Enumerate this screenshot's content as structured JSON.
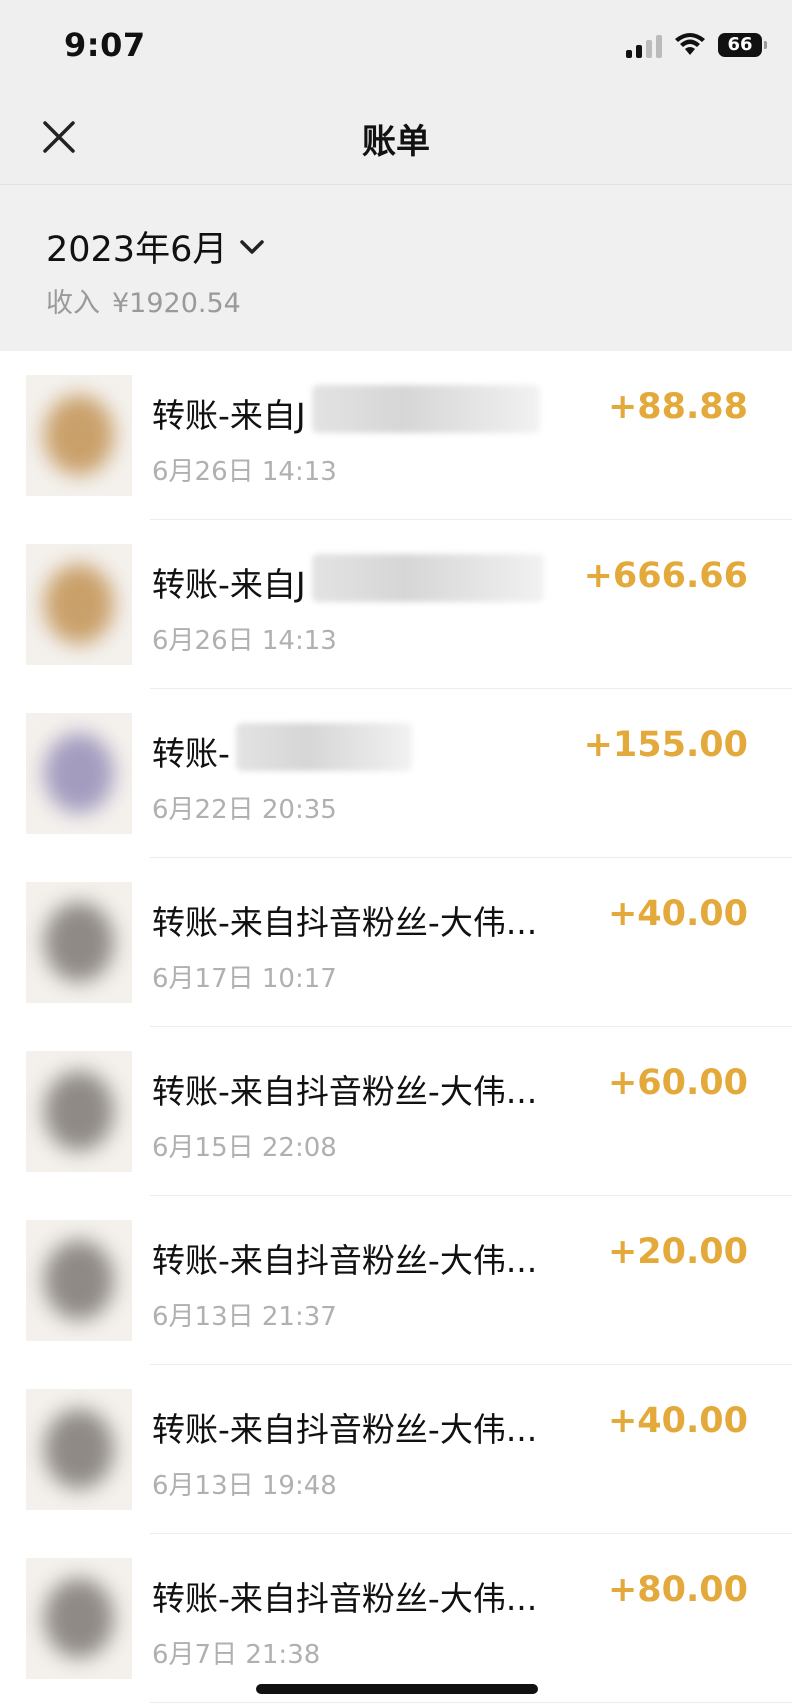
{
  "status": {
    "time": "9:07",
    "battery": "66"
  },
  "nav": {
    "title": "账单"
  },
  "summary": {
    "month": "2023年6月",
    "income_label": "收入",
    "income_amount": "¥1920.54"
  },
  "transactions": [
    {
      "title": "转账-来自J",
      "date": "6月26日 14:13",
      "amount": "+88.88",
      "avatar_color": "#c9a06a",
      "redacted": true
    },
    {
      "title": "转账-来自J",
      "date": "6月26日 14:13",
      "amount": "+666.66",
      "avatar_color": "#c9a06a",
      "redacted": true
    },
    {
      "title": "转账-",
      "date": "6月22日 20:35",
      "amount": "+155.00",
      "avatar_color": "#a49cbf",
      "redacted": true
    },
    {
      "title": "转账-来自抖音粉丝-大伟...",
      "date": "6月17日 10:17",
      "amount": "+40.00",
      "avatar_color": "#8f8a86",
      "redacted": false
    },
    {
      "title": "转账-来自抖音粉丝-大伟...",
      "date": "6月15日 22:08",
      "amount": "+60.00",
      "avatar_color": "#8f8a86",
      "redacted": false
    },
    {
      "title": "转账-来自抖音粉丝-大伟...",
      "date": "6月13日 21:37",
      "amount": "+20.00",
      "avatar_color": "#8f8a86",
      "redacted": false
    },
    {
      "title": "转账-来自抖音粉丝-大伟...",
      "date": "6月13日 19:48",
      "amount": "+40.00",
      "avatar_color": "#8f8a86",
      "redacted": false
    },
    {
      "title": "转账-来自抖音粉丝-大伟...",
      "date": "6月7日 21:38",
      "amount": "+80.00",
      "avatar_color": "#8f8a86",
      "redacted": false
    }
  ],
  "colors": {
    "amount": "#e3a93a",
    "background": "#f0f0f0"
  }
}
